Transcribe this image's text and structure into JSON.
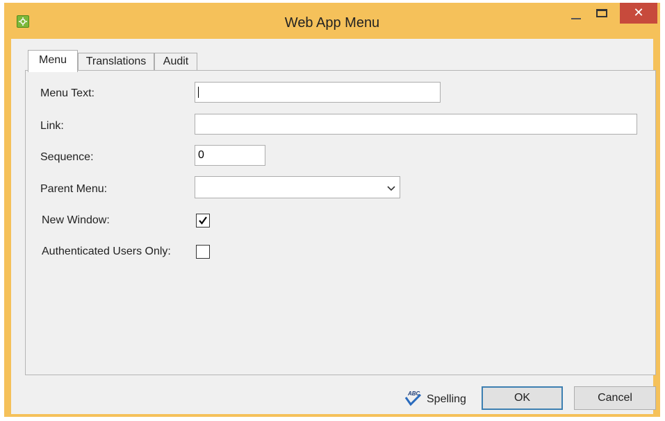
{
  "window": {
    "title": "Web App Menu",
    "close_glyph": "✕"
  },
  "tabs": [
    {
      "label": "Menu",
      "active": true
    },
    {
      "label": "Translations",
      "active": false
    },
    {
      "label": "Audit",
      "active": false
    }
  ],
  "form": {
    "menu_text": {
      "label": "Menu Text:",
      "value": ""
    },
    "link": {
      "label": "Link:",
      "value": ""
    },
    "sequence": {
      "label": "Sequence:",
      "value": "0"
    },
    "parent_menu": {
      "label": "Parent Menu:",
      "value": ""
    },
    "new_window": {
      "label": "New Window:",
      "checked": true
    },
    "authenticated_users_only": {
      "label": "Authenticated Users Only:",
      "checked": false
    }
  },
  "footer": {
    "spelling_label": "Spelling",
    "spelling_icon": "spellcheck-icon",
    "ok_label": "OK",
    "cancel_label": "Cancel"
  },
  "colors": {
    "titlebar": "#f5c15a",
    "close_button": "#c74a3c",
    "client_bg": "#f0f0f0"
  }
}
